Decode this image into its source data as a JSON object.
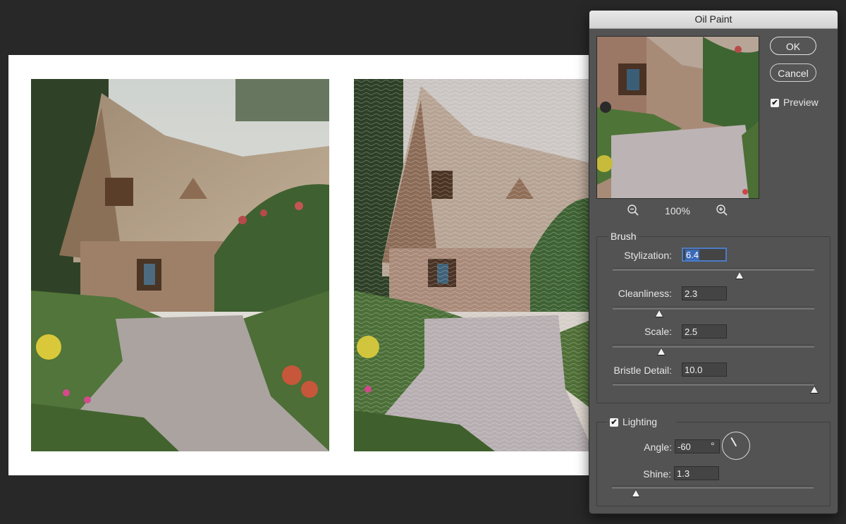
{
  "dialog": {
    "title": "Oil Paint",
    "ok_label": "OK",
    "cancel_label": "Cancel",
    "preview_label": "Preview",
    "preview_checked": true,
    "zoom_level": "100%"
  },
  "brush": {
    "group_label": "Brush",
    "stylization": {
      "label": "Stylization:",
      "value": "6.4",
      "slider_fraction": 0.63
    },
    "cleanliness": {
      "label": "Cleanliness:",
      "value": "2.3",
      "slider_fraction": 0.23
    },
    "scale": {
      "label": "Scale:",
      "value": "2.5",
      "slider_fraction": 0.24
    },
    "bristle_detail": {
      "label": "Bristle Detail:",
      "value": "10.0",
      "slider_fraction": 1.0
    }
  },
  "lighting": {
    "group_label": "Lighting",
    "enabled": true,
    "angle": {
      "label": "Angle:",
      "value": "-60",
      "unit": "°"
    },
    "shine": {
      "label": "Shine:",
      "value": "1.3",
      "slider_fraction": 0.12
    }
  },
  "icons": {
    "zoom_out": "zoom-out-icon",
    "zoom_in": "zoom-in-icon",
    "check": "✔"
  },
  "colors": {
    "dialog_bg": "#535353",
    "workspace_bg": "#282828",
    "focus_blue": "#4a7cc7"
  }
}
